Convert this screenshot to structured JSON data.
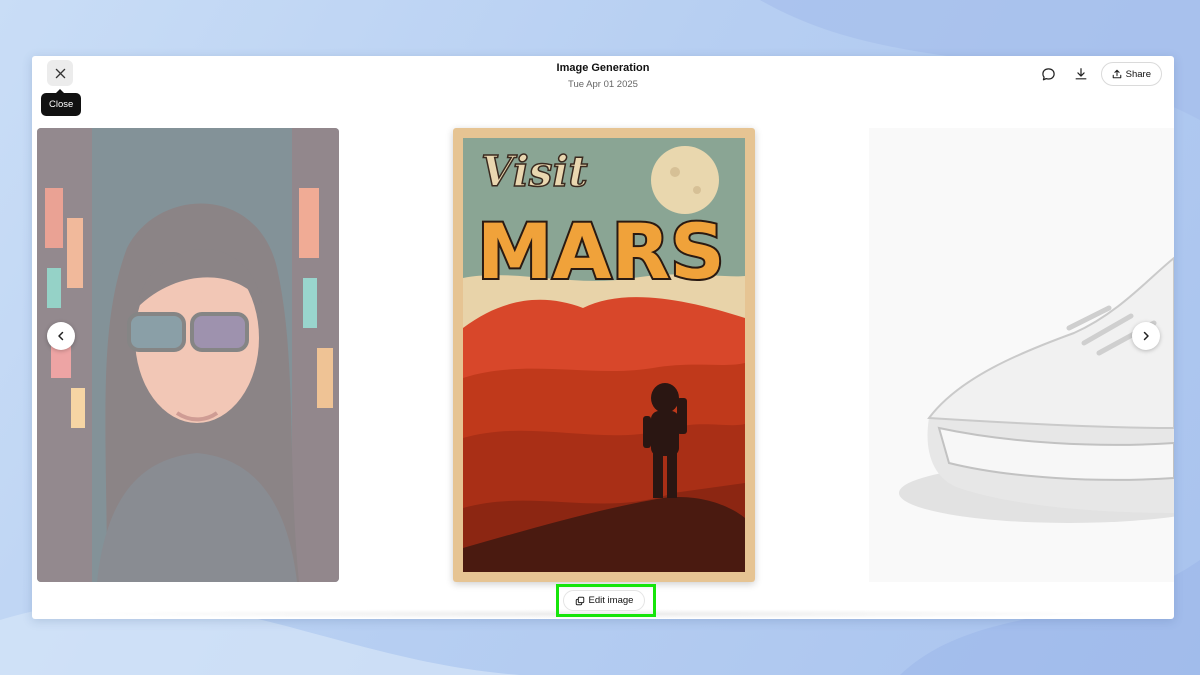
{
  "header": {
    "title": "Image Generation",
    "date": "Tue Apr 01 2025"
  },
  "close": {
    "tooltip": "Close",
    "icon": "close-icon"
  },
  "actions": {
    "comment_icon": "comment-icon",
    "download_icon": "download-icon",
    "share_label": "Share",
    "share_icon": "share-upload-icon"
  },
  "carousel": {
    "prev_icon": "chevron-left-icon",
    "next_icon": "chevron-right-icon",
    "center_poster": {
      "script_text": "Visit",
      "headline": "MARS"
    }
  },
  "edit": {
    "label": "Edit image",
    "icon": "edit-image-icon",
    "highlight_color": "#16e50a"
  },
  "colors": {
    "background": "#b7cff2",
    "poster_sand": "#e6c493",
    "poster_red": "#c0391b"
  }
}
